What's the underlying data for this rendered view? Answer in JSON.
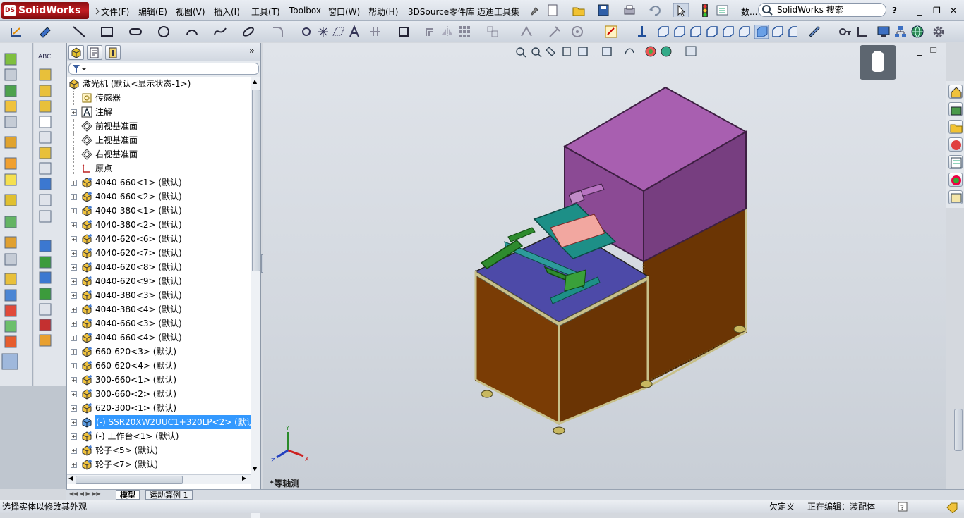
{
  "app": {
    "logo_text": "SolidWorks",
    "logo_badge": "DS"
  },
  "menu": [
    "文件(F)",
    "编辑(E)",
    "视图(V)",
    "插入(I)",
    "工具(T)",
    "Toolbox",
    "窗口(W)",
    "帮助(H)",
    "3DSource零件库",
    "迈迪工具集"
  ],
  "search": {
    "placeholder": "SolidWorks 搜索"
  },
  "search_extra": "数...",
  "featuremanager": {
    "tree": [
      {
        "label": "激光机 (默认<显示状态-1>)",
        "icon": "assembly-icon",
        "expandable": false,
        "root": true
      },
      {
        "label": "传感器",
        "icon": "sensor-icon",
        "expandable": false
      },
      {
        "label": "注解",
        "icon": "annotation-icon",
        "expandable": true
      },
      {
        "label": "前视基准面",
        "icon": "plane-icon",
        "expandable": false
      },
      {
        "label": "上视基准面",
        "icon": "plane-icon",
        "expandable": false
      },
      {
        "label": "右视基准面",
        "icon": "plane-icon",
        "expandable": false
      },
      {
        "label": "原点",
        "icon": "origin-icon",
        "expandable": false
      },
      {
        "label": "4040-660<1> (默认)",
        "icon": "part-icon",
        "expandable": true
      },
      {
        "label": "4040-660<2> (默认)",
        "icon": "part-icon",
        "expandable": true
      },
      {
        "label": "4040-380<1> (默认)",
        "icon": "part-icon",
        "expandable": true
      },
      {
        "label": "4040-380<2> (默认)",
        "icon": "part-icon",
        "expandable": true
      },
      {
        "label": "4040-620<6> (默认)",
        "icon": "part-icon",
        "expandable": true
      },
      {
        "label": "4040-620<7> (默认)",
        "icon": "part-icon",
        "expandable": true
      },
      {
        "label": "4040-620<8> (默认)",
        "icon": "part-icon",
        "expandable": true
      },
      {
        "label": "4040-620<9> (默认)",
        "icon": "part-icon",
        "expandable": true
      },
      {
        "label": "4040-380<3> (默认)",
        "icon": "part-icon",
        "expandable": true
      },
      {
        "label": "4040-380<4> (默认)",
        "icon": "part-icon",
        "expandable": true
      },
      {
        "label": "4040-660<3> (默认)",
        "icon": "part-icon",
        "expandable": true
      },
      {
        "label": "4040-660<4> (默认)",
        "icon": "part-icon",
        "expandable": true
      },
      {
        "label": "660-620<3> (默认)",
        "icon": "part-icon",
        "expandable": true
      },
      {
        "label": "660-620<4> (默认)",
        "icon": "part-icon",
        "expandable": true
      },
      {
        "label": "300-660<1> (默认)",
        "icon": "part-icon",
        "expandable": true
      },
      {
        "label": "300-660<2> (默认)",
        "icon": "part-icon",
        "expandable": true
      },
      {
        "label": "620-300<1> (默认)",
        "icon": "part-icon",
        "expandable": true
      },
      {
        "label": "(-) SSR20XW2UUC1+320LP<2> (默认<",
        "icon": "subassembly-icon",
        "expandable": true,
        "selected": true
      },
      {
        "label": "(-) 工作台<1> (默认)",
        "icon": "part-icon",
        "expandable": true
      },
      {
        "label": "轮子<5> (默认)",
        "icon": "part-icon",
        "expandable": true
      },
      {
        "label": "轮子<7> (默认)",
        "icon": "part-icon",
        "expandable": true
      }
    ]
  },
  "view_label": "*等轴测",
  "triad": {
    "x": "X",
    "y": "Y",
    "z": "Z"
  },
  "bottom_tabs": [
    "模型",
    "运动算例 1"
  ],
  "status": {
    "left": "选择实体以修改其外观",
    "mid": "欠定义",
    "right": "正在编辑：装配体"
  },
  "colors": {
    "cabinet": "#6b3504",
    "enclosure": "#8e4a8e",
    "top_plate": "#4a4aa0",
    "slide": "#1d8f87",
    "rail": "#2e8b2e",
    "selection": "#3399ff"
  }
}
